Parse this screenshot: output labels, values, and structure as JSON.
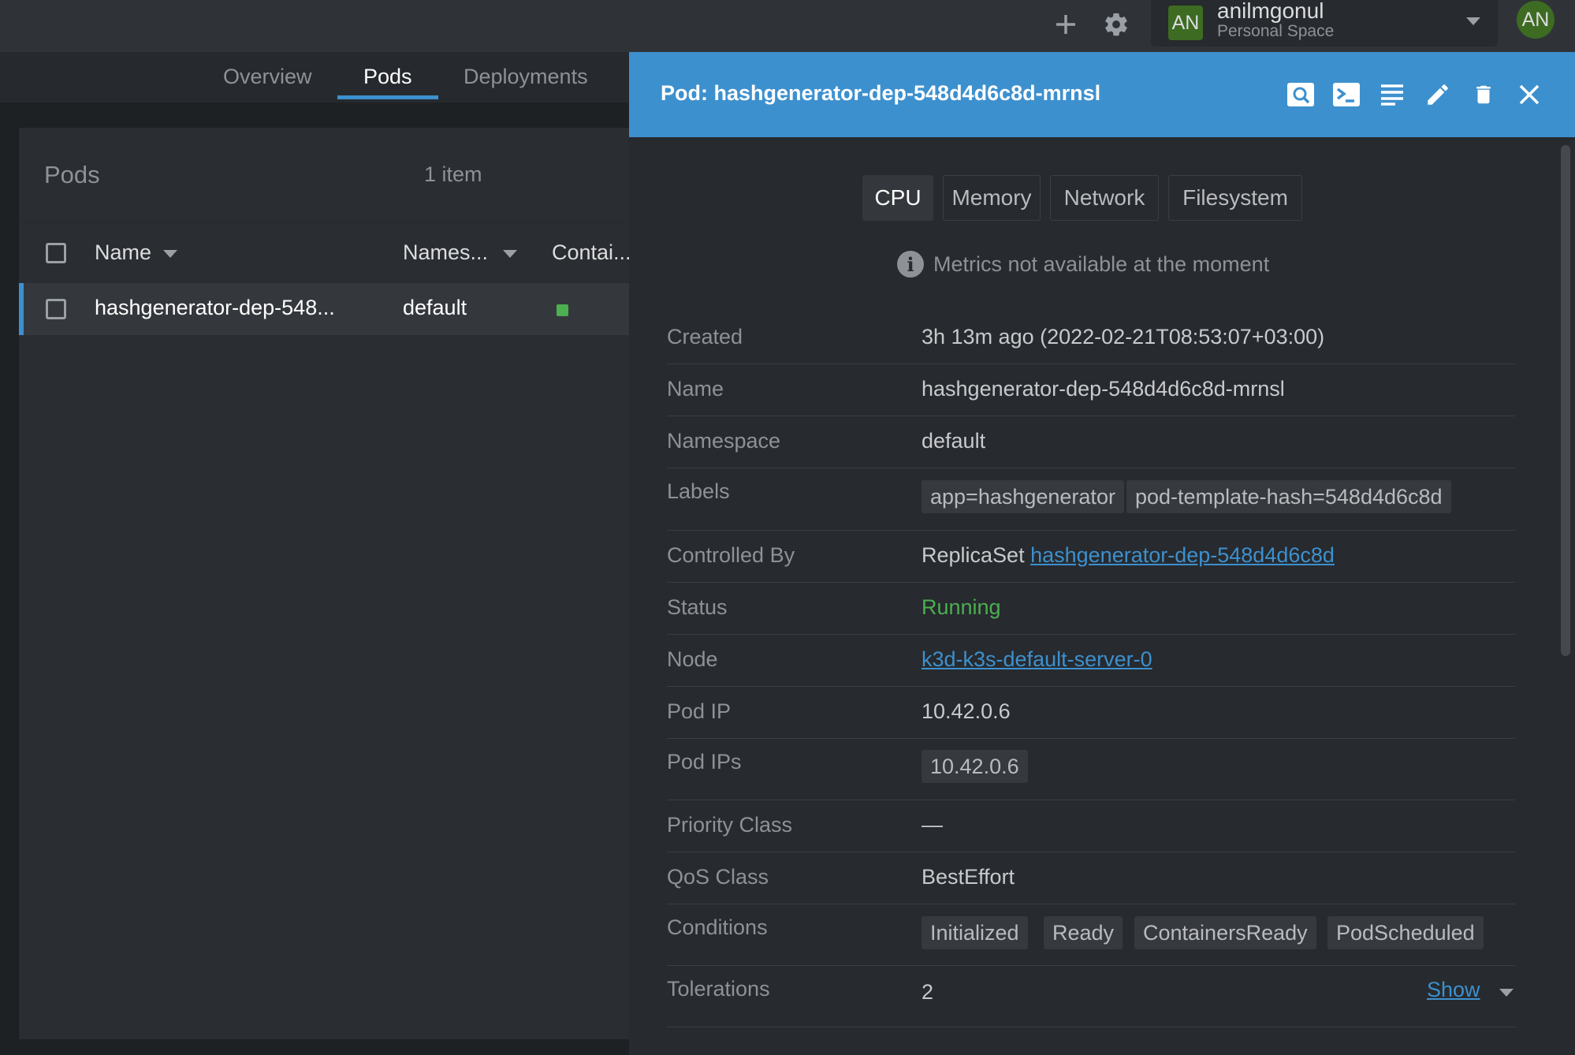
{
  "topbar": {
    "add_icon": "plus-icon",
    "settings_icon": "gear-icon",
    "workspace": {
      "avatar_initials": "AN",
      "name": "anilmgonul",
      "subtitle": "Personal Space"
    },
    "user_avatar_initials": "AN",
    "colors": {
      "background": "#2f3338",
      "avatar": "#3d6b22"
    }
  },
  "nav_tabs": [
    {
      "label": "Overview",
      "active": false
    },
    {
      "label": "Pods",
      "active": true
    },
    {
      "label": "Deployments",
      "active": false
    }
  ],
  "pods": {
    "title": "Pods",
    "count_label": "1 item",
    "columns": [
      "Name",
      "Names...",
      "Contai..."
    ],
    "rows": [
      {
        "name": "hashgenerator-dep-548...",
        "namespace": "default",
        "container_status": "running"
      }
    ]
  },
  "drawer": {
    "title": "Pod: hashgenerator-dep-548d4d6c8d-mrnsl",
    "actions": [
      "search-icon",
      "terminal-icon",
      "logs-icon",
      "edit-icon",
      "delete-icon",
      "close-icon"
    ],
    "metric_tabs": [
      {
        "label": "CPU",
        "active": true
      },
      {
        "label": "Memory",
        "active": false
      },
      {
        "label": "Network",
        "active": false
      },
      {
        "label": "Filesystem",
        "active": false
      }
    ],
    "metrics_notice": "Metrics not available at the moment",
    "details": {
      "created": {
        "label": "Created",
        "value": "3h 13m ago (2022-02-21T08:53:07+03:00)"
      },
      "name": {
        "label": "Name",
        "value": "hashgenerator-dep-548d4d6c8d-mrnsl"
      },
      "namespace": {
        "label": "Namespace",
        "value": "default"
      },
      "labels": {
        "label": "Labels",
        "values": [
          "app=hashgenerator",
          "pod-template-hash=548d4d6c8d"
        ]
      },
      "controlled_by": {
        "label": "Controlled By",
        "kind": "ReplicaSet",
        "link": "hashgenerator-dep-548d4d6c8d"
      },
      "status": {
        "label": "Status",
        "value": "Running"
      },
      "node": {
        "label": "Node",
        "link": "k3d-k3s-default-server-0"
      },
      "pod_ip": {
        "label": "Pod IP",
        "value": "10.42.0.6"
      },
      "pod_ips": {
        "label": "Pod IPs",
        "values": [
          "10.42.0.6"
        ]
      },
      "priority_class": {
        "label": "Priority Class",
        "value": "—"
      },
      "qos_class": {
        "label": "QoS Class",
        "value": "BestEffort"
      },
      "conditions": {
        "label": "Conditions",
        "values": [
          "Initialized",
          "Ready",
          "ContainersReady",
          "PodScheduled"
        ]
      },
      "tolerations": {
        "label": "Tolerations",
        "value": "2",
        "show_label": "Show"
      }
    },
    "colors": {
      "header": "#3d90ce",
      "status_running": "#4caf50",
      "link": "#3d90ce"
    }
  }
}
